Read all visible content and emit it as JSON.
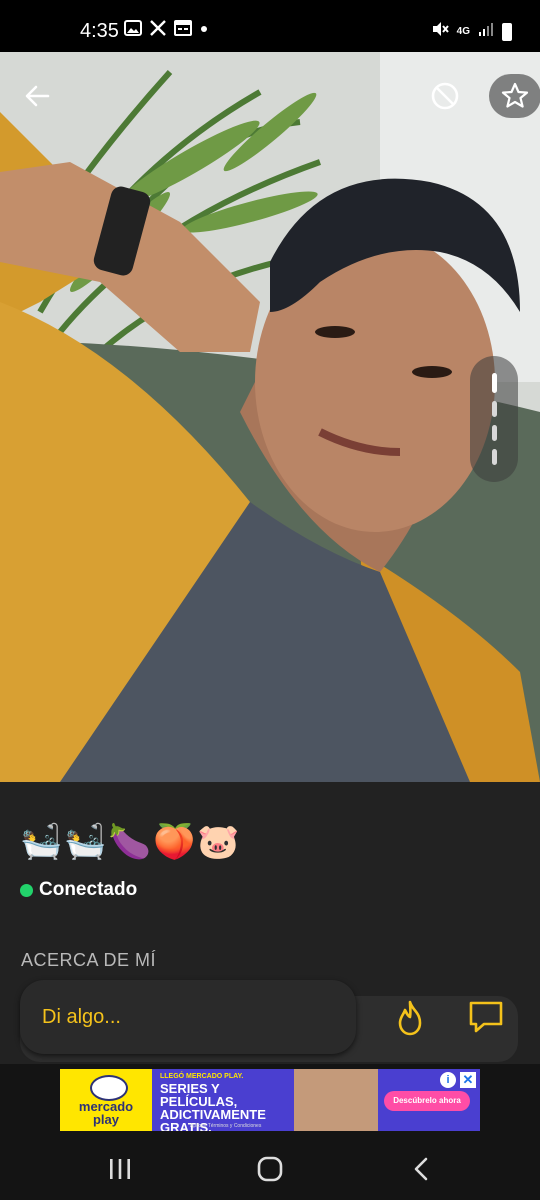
{
  "status_bar": {
    "time": "4:35",
    "left_icons": [
      "image-icon",
      "x-icon",
      "calendar-icon",
      "dot-icon"
    ],
    "right_icons": [
      "mute-icon",
      "4g-icon",
      "signal-icon",
      "battery-icon"
    ],
    "network_label": "4G"
  },
  "photo": {
    "pager_count": 4,
    "pager_active_index": 0
  },
  "profile": {
    "emoji_line": "🛀🛀🍆🍑🐷",
    "online_status": "Conectado",
    "online_color": "#22d36b",
    "about_heading": "ACERCA DE MÍ"
  },
  "chat": {
    "placeholder": "Di algo...",
    "accent_color": "#f4c21b"
  },
  "ad": {
    "brand_line1": "mercado",
    "brand_line2": "play",
    "kicker": "LLEGÓ MERCADO PLAY.",
    "headline": "SERIES Y PELÍCULAS, ADICTIVAMENTE GRATIS.",
    "cta": "Descúbrelo ahora",
    "disclaimer": "Aplican Términos y Condiciones"
  },
  "nav_bar": {
    "buttons": [
      "recents-icon",
      "home-icon",
      "back-icon"
    ]
  }
}
